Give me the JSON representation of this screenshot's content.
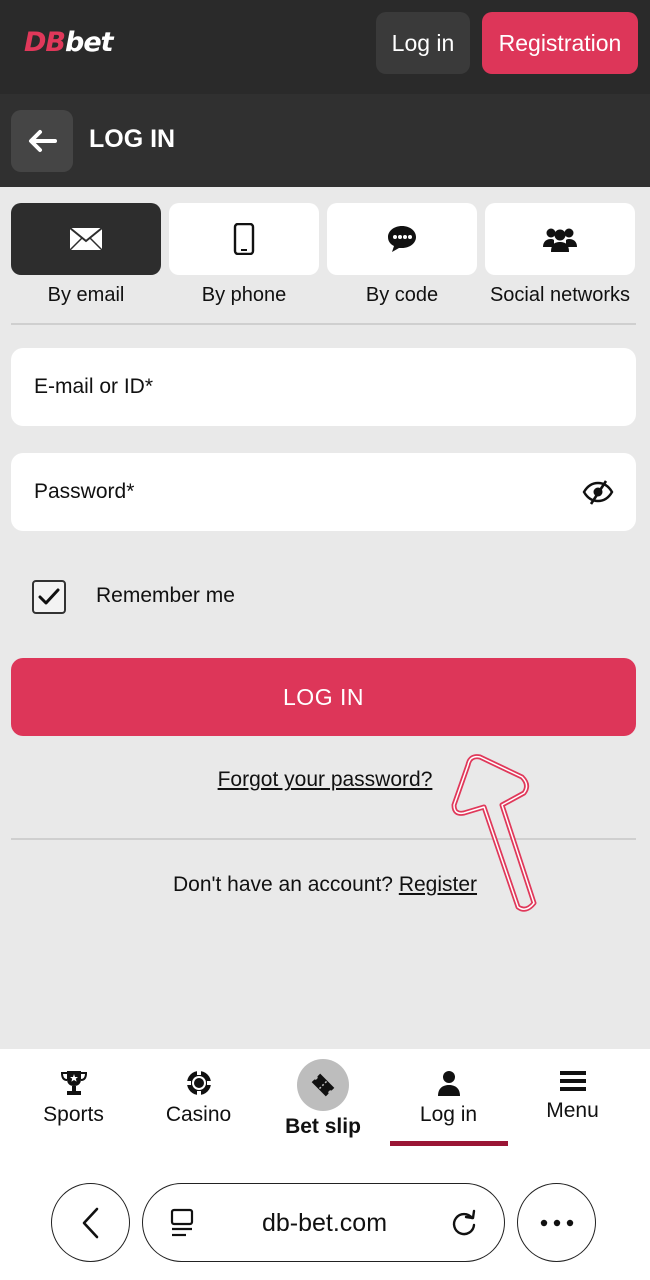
{
  "header": {
    "logo_db": "DB",
    "logo_bet": "bet",
    "login_label": "Log in",
    "registration_label": "Registration"
  },
  "subheader": {
    "title": "LOG IN"
  },
  "methods": [
    {
      "label": "By email",
      "icon": "envelope-icon",
      "active": true
    },
    {
      "label": "By phone",
      "icon": "smartphone-icon",
      "active": false
    },
    {
      "label": "By code",
      "icon": "chat-bubble-icon",
      "active": false
    },
    {
      "label": "Social networks",
      "icon": "users-icon",
      "active": false
    }
  ],
  "form": {
    "email_placeholder": "E-mail or ID*",
    "password_placeholder": "Password*",
    "remember_label": "Remember me",
    "remember_checked": true,
    "submit_label": "LOG IN",
    "forgot_label": "Forgot your password?",
    "no_account_text": "Don't have an account?",
    "register_link": "Register"
  },
  "bottom_nav": [
    {
      "label": "Sports",
      "icon": "trophy-icon"
    },
    {
      "label": "Casino",
      "icon": "casino-chip-icon"
    },
    {
      "label": "Bet slip",
      "icon": "ticket-icon"
    },
    {
      "label": "Log in",
      "icon": "person-icon",
      "active": true
    },
    {
      "label": "Menu",
      "icon": "hamburger-icon"
    }
  ],
  "browser": {
    "url": "db-bet.com"
  },
  "colors": {
    "accent": "#dd3659",
    "dark": "#2a2a2a",
    "background": "#e9e9e9"
  }
}
